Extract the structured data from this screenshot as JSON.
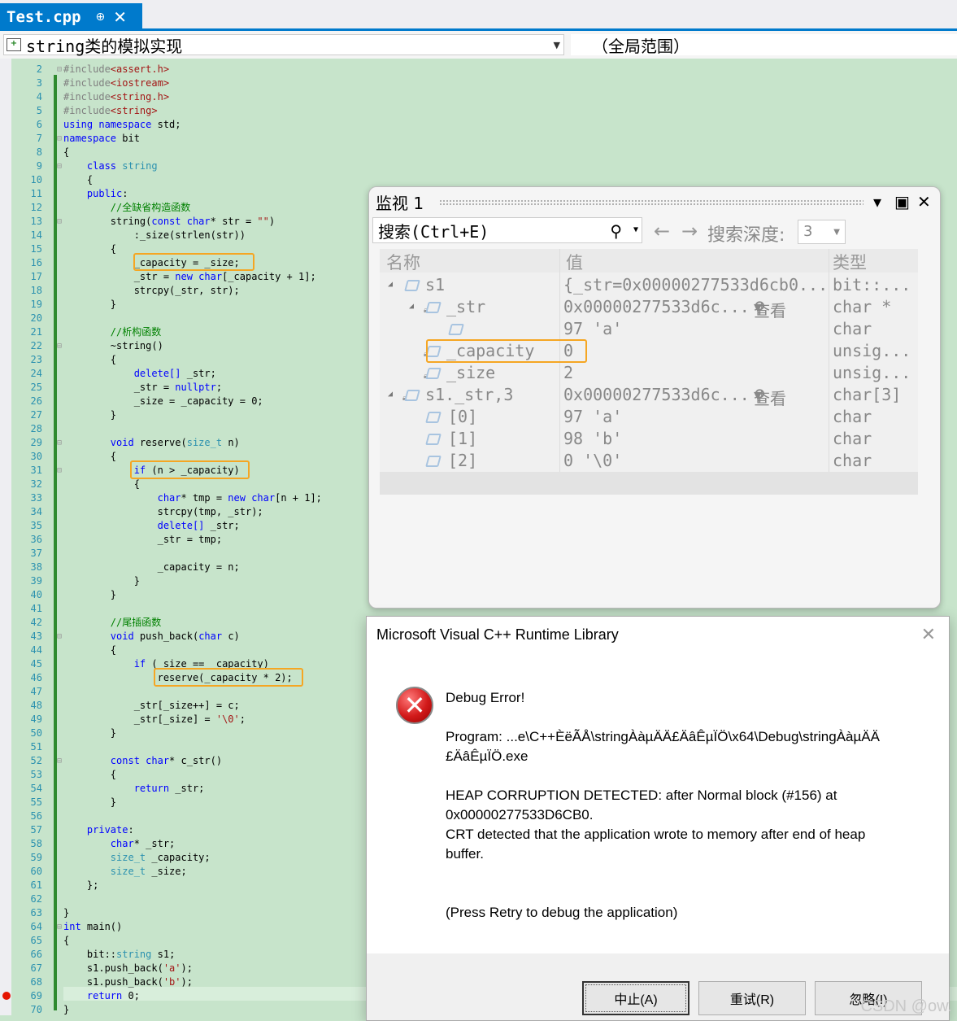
{
  "tab": {
    "title": "Test.cpp",
    "pin": "⊕",
    "close": "✕"
  },
  "nav": {
    "scope": "string类的模拟实现",
    "global_scope": "（全局范围）"
  },
  "editor": {
    "line_numbers": [
      "2",
      "3",
      "4",
      "5",
      "6",
      "7",
      "8",
      "9",
      "10",
      "11",
      "12",
      "13",
      "14",
      "15",
      "16",
      "17",
      "18",
      "19",
      "20",
      "21",
      "22",
      "23",
      "24",
      "25",
      "26",
      "27",
      "28",
      "29",
      "30",
      "31",
      "32",
      "33",
      "34",
      "35",
      "36",
      "37",
      "38",
      "39",
      "40",
      "41",
      "42",
      "43",
      "44",
      "45",
      "46",
      "47",
      "48",
      "49",
      "50",
      "51",
      "52",
      "53",
      "54",
      "55",
      "56",
      "57",
      "58",
      "59",
      "60",
      "61",
      "62",
      "63",
      "64",
      "65",
      "66",
      "67",
      "68",
      "69",
      "70"
    ],
    "code": {
      "l2a": "#include",
      "l2b": "<assert.h>",
      "l3a": "#include",
      "l3b": "<iostream>",
      "l4a": "#include",
      "l4b": "<string.h>",
      "l5a": "#include",
      "l5b": "<string>",
      "l6a": "using namespace",
      "l6b": " std;",
      "l7a": "namespace",
      "l7b": " bit",
      "l8": "{",
      "l9a": "    class",
      "l9b": " string",
      "l10": "    {",
      "l11a": "    public",
      "l11b": ":",
      "l12": "        //全缺省构造函数",
      "l13a": "        string(",
      "l13b": "const char",
      "l13c": "* str = ",
      "l13d": "\"\"",
      "l13e": ")",
      "l14": "            :_size(strlen(str))",
      "l15": "        {",
      "l16": "            _capacity = _size;",
      "l17a": "            _str = ",
      "l17b": "new char",
      "l17c": "[_capacity + 1];",
      "l18": "            strcpy(_str, str);",
      "l19": "        }",
      "l20": "",
      "l21": "        //析构函数",
      "l22": "        ~string()",
      "l23": "        {",
      "l24a": "            ",
      "l24b": "delete[]",
      "l24c": " _str;",
      "l25a": "            _str = ",
      "l25b": "nullptr",
      "l25c": ";",
      "l26": "            _size = _capacity = 0;",
      "l27": "        }",
      "l28": "",
      "l29a": "        ",
      "l29b": "void",
      "l29c": " reserve(",
      "l29d": "size_t",
      "l29e": " n)",
      "l30": "        {",
      "l31a": "            ",
      "l31b": "if",
      "l31c": " (n > _capacity)",
      "l32": "            {",
      "l33a": "                ",
      "l33b": "char",
      "l33c": "* tmp = ",
      "l33d": "new char",
      "l33e": "[n + 1];",
      "l34": "                strcpy(tmp, _str);",
      "l35a": "                ",
      "l35b": "delete[]",
      "l35c": " _str;",
      "l36": "                _str = tmp;",
      "l37": "",
      "l38": "                _capacity = n;",
      "l39": "            }",
      "l40": "        }",
      "l41": "",
      "l42": "        //尾插函数",
      "l43a": "        ",
      "l43b": "void",
      "l43c": " push_back(",
      "l43d": "char",
      "l43e": " c)",
      "l44": "        {",
      "l45a": "            ",
      "l45b": "if",
      "l45c": " (_size == _capacity)",
      "l46": "                reserve(_capacity * 2);",
      "l47": "",
      "l48": "            _str[_size++] = c;",
      "l49a": "            _str[_size] = ",
      "l49b": "'\\0'",
      "l49c": ";",
      "l50": "        }",
      "l51": "",
      "l52a": "        ",
      "l52b": "const char",
      "l52c": "* c_str()",
      "l53": "        {",
      "l54a": "            ",
      "l54b": "return",
      "l54c": " _str;",
      "l55": "        }",
      "l56": "",
      "l57a": "    ",
      "l57b": "private",
      "l57c": ":",
      "l58a": "        ",
      "l58b": "char",
      "l58c": "* _str;",
      "l59a": "        ",
      "l59b": "size_t",
      "l59c": " _capacity;",
      "l60a": "        ",
      "l60b": "size_t",
      "l60c": " _size;",
      "l61": "    };",
      "l62": "",
      "l63": "}",
      "l64a": "int",
      "l64b": " main()",
      "l65": "{",
      "l66a": "    bit::",
      "l66b": "string",
      "l66c": " s1;",
      "l67a": "    s1.push_back(",
      "l67b": "'a'",
      "l67c": ");",
      "l68a": "    s1.push_back(",
      "l68b": "'b'",
      "l68c": ");",
      "l69a": "    ",
      "l69b": "return",
      "l69c": " 0;",
      "l70": "}"
    }
  },
  "watch": {
    "title": "监视 1",
    "dropdown_icon": "▾",
    "maximize_icon": "▣",
    "close_icon": "✕",
    "search_placeholder": "搜索(Ctrl+E)",
    "back_arrow": "←",
    "forward_arrow": "→",
    "depth_label": "搜索深度:",
    "depth_value": "3",
    "columns": {
      "name": "名称",
      "value": "值",
      "type": "类型"
    },
    "rows": [
      {
        "name": "s1",
        "value": "{_str=0x00000277533d6cb0...",
        "type": "bit::..."
      },
      {
        "name": "_str",
        "value": "0x00000277533d6c...",
        "view": "查看",
        "type": "char *"
      },
      {
        "name": "",
        "value": "97 'a'",
        "type": "char"
      },
      {
        "name": "_capacity",
        "value": "0",
        "type": "unsig..."
      },
      {
        "name": "_size",
        "value": "2",
        "type": "unsig..."
      },
      {
        "name": "s1._str,3",
        "value": "0x00000277533d6c...",
        "view": "查看",
        "type": "char[3]"
      },
      {
        "name": "[0]",
        "value": "97 'a'",
        "type": "char"
      },
      {
        "name": "[1]",
        "value": "98 'b'",
        "type": "char"
      },
      {
        "name": "[2]",
        "value": "0 '\\0'",
        "type": "char"
      }
    ]
  },
  "dialog": {
    "title": "Microsoft Visual C++ Runtime Library",
    "close": "✕",
    "icon_glyph": "✕",
    "heading": "Debug Error!",
    "program_line1": "Program: ...e\\C++ÈëÃÅ\\stringÀàµÄÄ£ÄâÊµÏÖ\\x64\\Debug\\stringÀàµÄÄ",
    "program_line2": "£ÄâÊµÏÖ.exe",
    "heap_line1": "HEAP CORRUPTION DETECTED: after Normal block (#156) at",
    "heap_line2": "0x00000277533D6CB0.",
    "crt_line1": "CRT detected that the application wrote to memory after end of heap",
    "crt_line2": "buffer.",
    "retry_hint": "(Press Retry to debug the application)",
    "buttons": {
      "abort": "中止(A)",
      "retry": "重试(R)",
      "ignore": "忽略(I)"
    }
  },
  "watermark": "CSDN @ow.",
  "colors": {
    "editor_bg": "#c7e4cb",
    "accent": "#007acc",
    "highlight_box": "#f5a623",
    "keyword": "#0000ff",
    "type": "#2b91af",
    "comment": "#008000",
    "string": "#a31515"
  }
}
